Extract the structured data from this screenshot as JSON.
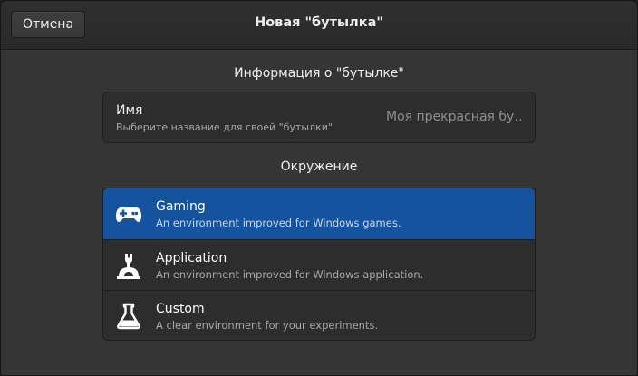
{
  "header": {
    "cancel_label": "Отмена",
    "title": "Новая \"бутылка\""
  },
  "info_section": {
    "title": "Информация о \"бутылке\"",
    "name_label": "Имя",
    "name_subtitle": "Выберите название для своей \"бутылки\"",
    "name_placeholder": "Моя прекрасная бу…"
  },
  "environment_section": {
    "title": "Окружение",
    "options": [
      {
        "title": "Gaming",
        "subtitle": "An environment improved for Windows games.",
        "icon": "gamepad-icon",
        "selected": true
      },
      {
        "title": "Application",
        "subtitle": "An environment improved for Windows application.",
        "icon": "wrench-icon",
        "selected": false
      },
      {
        "title": "Custom",
        "subtitle": "A clear environment for your experiments.",
        "icon": "flask-icon",
        "selected": false
      }
    ]
  },
  "colors": {
    "accent": "#15539e",
    "window_bg": "#353535",
    "card_bg": "#2d2d2d"
  }
}
